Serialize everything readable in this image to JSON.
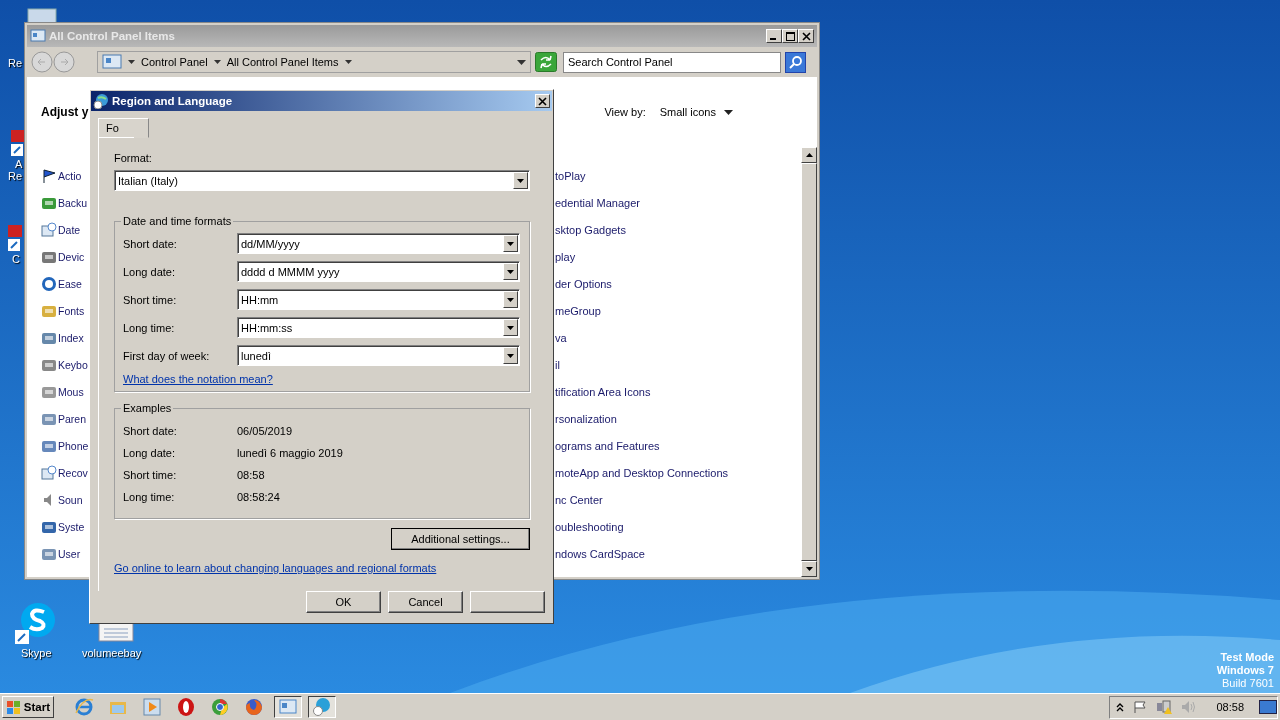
{
  "desktop": {
    "icons": [
      {
        "label": "Re",
        "kind": "recycle"
      },
      {
        "label": "A",
        "kind": "app"
      },
      {
        "label": "Re",
        "kind": "text"
      },
      {
        "label": "C",
        "kind": "app"
      },
      {
        "label": "Skype",
        "kind": "skype"
      },
      {
        "label": "volumeebay",
        "kind": "doc"
      }
    ],
    "notice": [
      "Test Mode",
      "Windows 7",
      "Build 7601"
    ]
  },
  "control_panel": {
    "title": "All Control Panel Items",
    "breadcrumb": [
      "Control Panel",
      "All Control Panel Items"
    ],
    "search": {
      "placeholder": "Search Control Panel"
    },
    "heading": "Adjust y",
    "view_by_label": "View by:",
    "view_by_value": "Small icons",
    "left_items": [
      {
        "label": "Actio",
        "kind": "flag"
      },
      {
        "label": "Backu",
        "kind": "backup"
      },
      {
        "label": "Date",
        "kind": "clock"
      },
      {
        "label": "Devic",
        "kind": "printer"
      },
      {
        "label": "Ease",
        "kind": "ease"
      },
      {
        "label": "Fonts",
        "kind": "folder"
      },
      {
        "label": "Index",
        "kind": "user"
      },
      {
        "label": "Keybo",
        "kind": "keyboard"
      },
      {
        "label": "Mous",
        "kind": "mouse"
      },
      {
        "label": "Paren",
        "kind": "people"
      },
      {
        "label": "Phone",
        "kind": "phone"
      },
      {
        "label": "Recov",
        "kind": "clock"
      },
      {
        "label": "Soun",
        "kind": "speaker"
      },
      {
        "label": "Syste",
        "kind": "monitor"
      },
      {
        "label": "User",
        "kind": "people"
      }
    ],
    "right_items": [
      "toPlay",
      "edential Manager",
      "sktop Gadgets",
      "play",
      "der Options",
      "meGroup",
      "va",
      "il",
      "tification Area Icons",
      "rsonalization",
      "ograms and Features",
      "moteApp and Desktop Connections",
      "nc Center",
      "oubleshooting",
      "ndows CardSpace"
    ]
  },
  "dialog": {
    "title": "Region and Language",
    "tabs": [
      {
        "label": "Fo",
        "selected": true
      }
    ],
    "format_label": "Format:",
    "format_value": "Italian (Italy)",
    "group_title": "Date and time formats",
    "fields": [
      {
        "label": "Short date:",
        "value": "dd/MM/yyyy"
      },
      {
        "label": "Long date:",
        "value": "dddd d MMMM yyyy"
      },
      {
        "label": "Short time:",
        "value": "HH:mm"
      },
      {
        "label": "Long time:",
        "value": "HH:mm:ss"
      },
      {
        "label": "First day of week:",
        "value": "lunedì"
      }
    ],
    "notation_link": "What does the notation mean?",
    "examples_title": "Examples",
    "examples": [
      {
        "label": "Short date:",
        "value": "06/05/2019"
      },
      {
        "label": "Long date:",
        "value": "lunedì 6 maggio 2019"
      },
      {
        "label": "Short time:",
        "value": "08:58"
      },
      {
        "label": "Long time:",
        "value": "08:58:24"
      }
    ],
    "additional_button": "Additional settings...",
    "online_link": "Go online to learn about changing languages and regional formats",
    "buttons": [
      {
        "kind": "text",
        "label": "OK"
      },
      {
        "kind": "text",
        "label": "Cancel"
      },
      {
        "kind": "blank"
      }
    ]
  },
  "taskbar": {
    "start_label": "Start",
    "apps": [
      {
        "kind": "ie",
        "pressed": false
      },
      {
        "kind": "explorer",
        "pressed": false
      },
      {
        "kind": "media",
        "pressed": false
      },
      {
        "kind": "opera",
        "pressed": false
      },
      {
        "kind": "chrome",
        "pressed": false
      },
      {
        "kind": "firefox",
        "pressed": false
      },
      {
        "kind": "control",
        "pressed": true
      },
      {
        "kind": "globe",
        "pressed": true
      }
    ],
    "clock": "08:58"
  }
}
